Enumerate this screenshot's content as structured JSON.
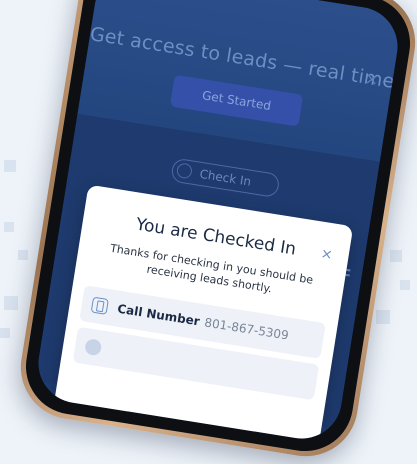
{
  "hero": {
    "title": "Get access to leads — real time.",
    "cta_label": "Get Started",
    "close_glyph": "×"
  },
  "checkin": {
    "button_label": "Check In"
  },
  "modal": {
    "title": "You are Checked In",
    "message": "Thanks for checking in you should be receiving leads shortly.",
    "close_glyph": "×",
    "rows": [
      {
        "icon": "phone-icon",
        "label": "Call Number",
        "value": "801-867-5309"
      }
    ]
  },
  "colors": {
    "accent": "#6a8fc8",
    "screen_bg": "#1f3e74",
    "phone_frame": "#b48a63"
  }
}
